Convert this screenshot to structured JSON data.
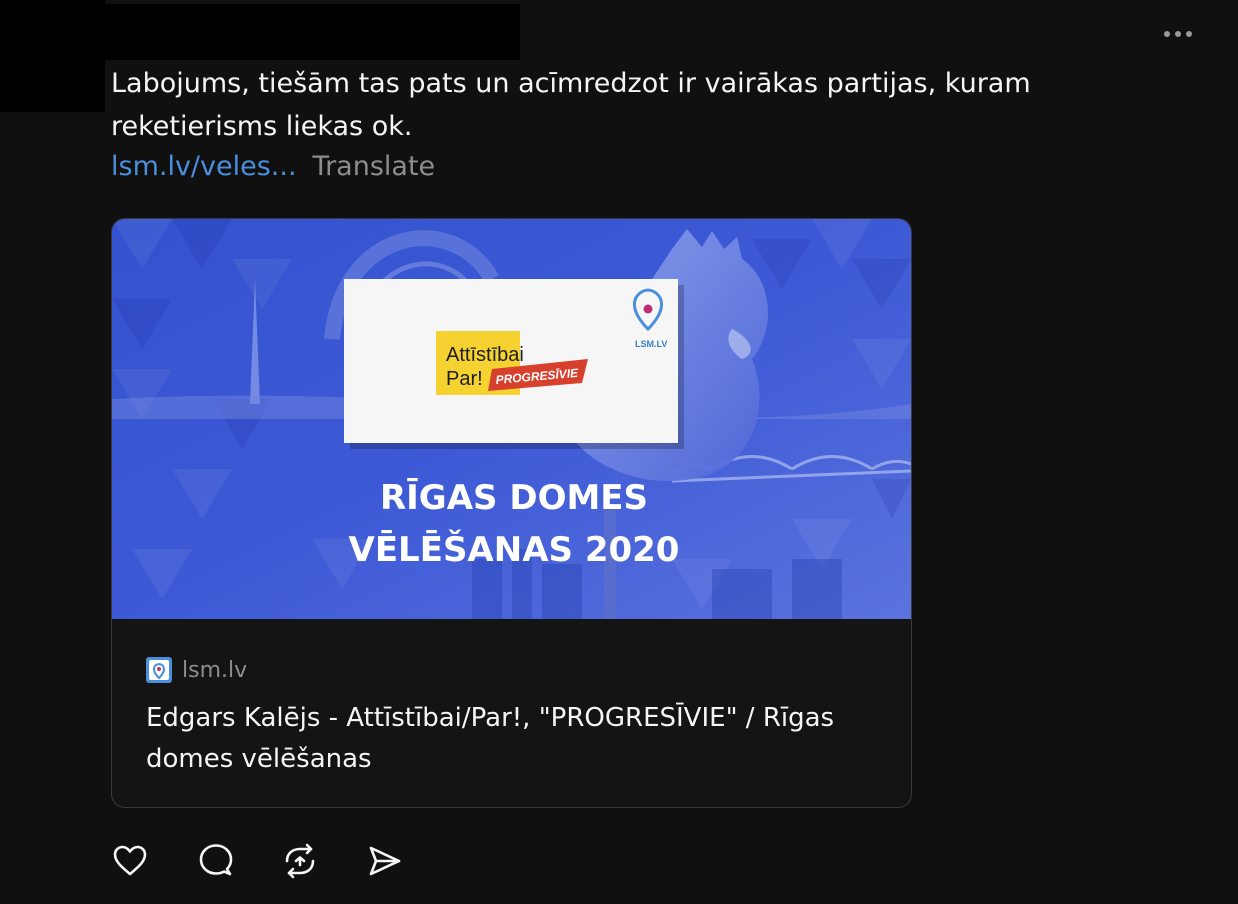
{
  "post": {
    "text": "Labojums, tiešām tas pats un acīmredzot ir vairākas partijas, kuram reketierisms liekas ok.",
    "link_text": "lsm.lv/veles...",
    "translate_label": "Translate"
  },
  "link_card": {
    "image": {
      "logo_line1": "Attīstībai",
      "logo_line2": "Par!",
      "logo_badge": "PROGRESĪVIE",
      "source_label": "LSM.LV",
      "headline_line1": "RĪGAS DOMES",
      "headline_line2": "VĒLĒŠANAS 2020"
    },
    "domain": "lsm.lv",
    "title": "Edgars Kalējs - Attīstībai/Par!, \"PROGRESĪVIE\" / Rīgas domes vēlēšanas"
  },
  "actions": {
    "icons": [
      "heart-icon",
      "comment-icon",
      "repost-icon",
      "share-icon"
    ]
  },
  "colors": {
    "background": "#101010",
    "link": "#4a8fde",
    "muted": "#8d8d8d",
    "card_image_blue": "#3d59d6",
    "logo_yellow": "#f5d230",
    "logo_red": "#d8402e"
  }
}
